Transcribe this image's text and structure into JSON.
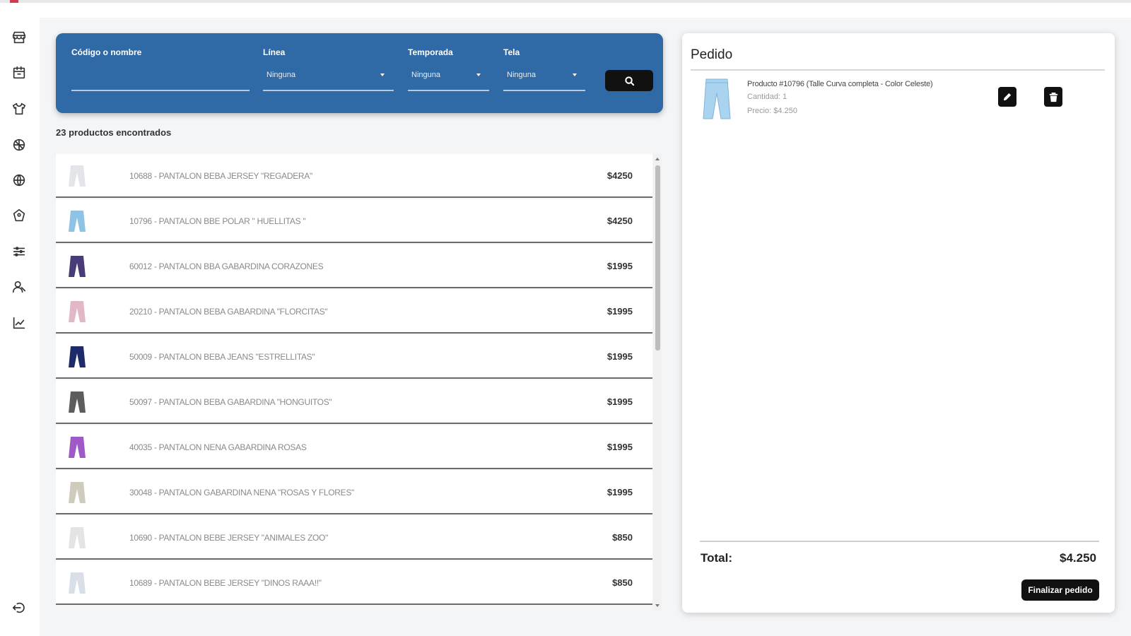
{
  "filters": {
    "code_label": "Código o nombre",
    "line_label": "Línea",
    "line_value": "Ninguna",
    "season_label": "Temporada",
    "season_value": "Ninguna",
    "fabric_label": "Tela",
    "fabric_value": "Ninguna"
  },
  "results_count": "23 productos encontrados",
  "products": [
    {
      "name": "10688 - PANTALON BEBA JERSEY \"REGADERA\"",
      "price": "$4250",
      "thumb_color": "#e3e5ea"
    },
    {
      "name": "10796 - PANTALON BBE POLAR \" HUELLITAS \"",
      "price": "$4250",
      "thumb_color": "#8fc3e6"
    },
    {
      "name": "60012 - PANTALON BBA GABARDINA CORAZONES",
      "price": "$1995",
      "thumb_color": "#4a3c78"
    },
    {
      "name": "20210 - PANTALON BEBA GABARDINA \"FLORCITAS\"",
      "price": "$1995",
      "thumb_color": "#e2b8c8"
    },
    {
      "name": "50009 - PANTALON BEBA JEANS \"ESTRELLITAS\"",
      "price": "$1995",
      "thumb_color": "#1e2b6b"
    },
    {
      "name": "50097 - PANTALON BEBA GABARDINA \"HONGUITOS\"",
      "price": "$1995",
      "thumb_color": "#5d5d5d"
    },
    {
      "name": "40035 - PANTALON NENA GABARDINA ROSAS",
      "price": "$1995",
      "thumb_color": "#a05ac7"
    },
    {
      "name": "30048 - PANTALON GABARDINA NENA \"ROSAS Y FLORES\"",
      "price": "$1995",
      "thumb_color": "#cfcbbd"
    },
    {
      "name": "10690 - PANTALON BEBE JERSEY \"ANIMALES ZOO\"",
      "price": "$850",
      "thumb_color": "#e4e4e4"
    },
    {
      "name": "10689 - PANTALON BEBE JERSEY \"DINOS RAAA!!\"",
      "price": "$850",
      "thumb_color": "#d8dfe6"
    }
  ],
  "order": {
    "title": "Pedido",
    "item_name": "Producto #10796 (Talle Curva completa - Color Celeste)",
    "item_qty": "Cantidad: 1",
    "item_price": "Precio: $4.250",
    "total_label": "Total:",
    "total_value": "$4.250",
    "finish_label": "Finalizar pedido"
  },
  "sidebar_icons": [
    "store-icon",
    "calendar-icon",
    "shirt-icon",
    "ball-icon",
    "globe-icon",
    "tag-icon",
    "sliders-icon",
    "users-icon",
    "chart-icon"
  ],
  "colors": {
    "accent": "#2f6aa6",
    "dark_button": "#111111",
    "brand_red": "#d33b4c"
  }
}
